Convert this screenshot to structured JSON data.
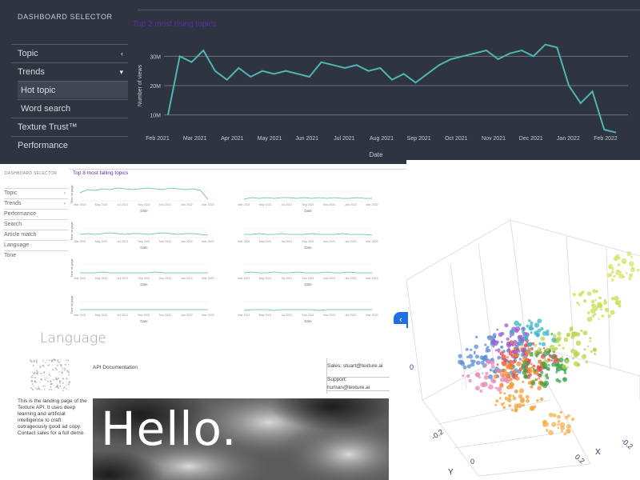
{
  "dark_dashboard": {
    "sidebar_title": "DASHBOARD SELECTOR",
    "nav": [
      {
        "label": "Topic",
        "arrow": "‹"
      },
      {
        "label": "Trends",
        "arrow": "▾"
      },
      {
        "label": "Hot topic",
        "arrow": ""
      },
      {
        "label": "Word search",
        "arrow": ""
      },
      {
        "label": "Texture Trust™",
        "arrow": ""
      },
      {
        "label": "Performance",
        "arrow": ""
      }
    ],
    "active_index": 2,
    "chart_title": "Top 2 most rising topics",
    "colors": {
      "bg": "#2e3440",
      "line": "#4fb7b3",
      "title": "#5b2ba8"
    }
  },
  "light_dashboard": {
    "sidebar_title": "DASHBOARD SELECTOR",
    "nav": [
      {
        "label": "Topic",
        "arrow": "‹"
      },
      {
        "label": "Trends",
        "arrow": "‹"
      },
      {
        "label": "Performance",
        "arrow": ""
      },
      {
        "label": "Search",
        "arrow": ""
      },
      {
        "label": "Article match",
        "arrow": ""
      },
      {
        "label": "Language",
        "arrow": ""
      },
      {
        "label": "Tone",
        "arrow": ""
      }
    ],
    "chart_title": "Top 8 most falling topics"
  },
  "landing": {
    "heading": "Language",
    "blurb": "This is the landing page of the Texture API. It uses deep learning and artificial intelligence to craft outrageously good ad copy. Contact sales for a full demo.",
    "api_doc": "API Documentation",
    "sales": "Sales: stuart@texture.ai",
    "support": "Support: human@texture.ai",
    "hero_text": "Hello."
  },
  "scatter": {
    "tick_labels": [
      "0",
      "-0.2",
      "-0.2",
      "0",
      "0.2"
    ],
    "axis_labels": [
      "Y",
      "X"
    ],
    "collapse_icon": "‹"
  },
  "chart_data": [
    {
      "type": "line",
      "title": "Top 2 most rising topics",
      "xlabel": "Date",
      "ylabel": "Number of views",
      "x": [
        "Feb 2021",
        "Mar 2021",
        "Apr 2021",
        "May 2021",
        "Jun 2021",
        "Jul 2021",
        "Aug 2021",
        "Sep 2021",
        "Oct 2021",
        "Nov 2021",
        "Dec 2021",
        "Jan 2022",
        "Feb 2022"
      ],
      "yticks": [
        "10M",
        "20M",
        "30M"
      ],
      "ylim": [
        5,
        35
      ],
      "series": [
        {
          "values": [
            10,
            30,
            28,
            32,
            25,
            22,
            26,
            23,
            25,
            24,
            25,
            24,
            23,
            28,
            27,
            26,
            27,
            25,
            26,
            22,
            24,
            21,
            24,
            27,
            29,
            30,
            31,
            32,
            29,
            31,
            32,
            30,
            34,
            33,
            20,
            14,
            18,
            5,
            4
          ]
        }
      ]
    },
    {
      "type": "line",
      "title": "Top 8 most falling topics",
      "xlabel": "Date",
      "ylabel": "Time on page",
      "x": [
        "Mar 2021",
        "May 2021",
        "Jul 2021",
        "Sep 2021",
        "Nov 2021",
        "Jan 2022",
        "Mar 2022"
      ],
      "panels": [
        "",
        "",
        "",
        "",
        "",
        "",
        "",
        ""
      ]
    }
  ]
}
